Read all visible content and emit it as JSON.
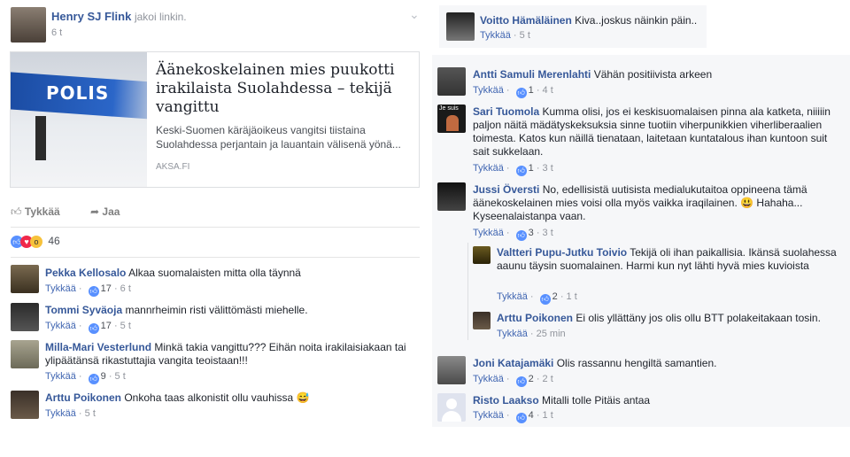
{
  "post": {
    "author": "Henry SJ Flink",
    "action": "jakoi linkin.",
    "time": "6 t",
    "link_title": "Äänekoskelainen mies puukotti irakilaista Suolahdessa – tekijä vangittu",
    "link_desc": "Keski-Suomen käräjäoikeus vangitsi tiistaina Suolahdessa perjantain ja lauantain välisenä yönä...",
    "link_source": "AKSA.FI",
    "police_text": "POLIS",
    "like_label": "Tykkää",
    "share_label": "Jaa",
    "reaction_count": "46"
  },
  "left_comments": [
    {
      "name": "Pekka Kellosalo",
      "text": "Alkaa suomalaisten mitta olla täynnä",
      "like": "Tykkää",
      "count": "17",
      "time": "6 t"
    },
    {
      "name": "Tommi Syväoja",
      "text": "mannrheimin risti välittömästi miehelle.",
      "like": "Tykkää",
      "count": "17",
      "time": "5 t"
    },
    {
      "name": "Milla-Mari Vesterlund",
      "text": "Minkä takia vangittu??? Eihän noita irakilaisiakaan tai ylipäätänsä rikastuttajia vangita teoistaan!!!",
      "like": "Tykkää",
      "count": "9",
      "time": "5 t"
    },
    {
      "name": "Arttu Poikonen",
      "text": "Onkoha taas alkonistit ollu vauhissa 😅",
      "like": "Tykkää",
      "count": "",
      "time": "5 t"
    }
  ],
  "top_right_comment": {
    "name": "Voitto Hämäläinen",
    "text": "Kiva..joskus näinkin päin..",
    "like": "Tykkää",
    "time": "5 t"
  },
  "right_comments": [
    {
      "name": "Antti Samuli Merenlahti",
      "text": "Vähän positiivista arkeen",
      "like": "Tykkää",
      "count": "1",
      "time": "4 t"
    },
    {
      "name": "Sari Tuomola",
      "text": "Kumma olisi, jos ei keskisuomalaisen pinna ala katketa, niiiiin paljon näitä mädätyskeksuksia sinne tuotiin viherpunikkien viherliberaalien toimesta. Katos kun näillä tienataan, laitetaan kuntatalous ihan kuntoon suit sait sukkelaan.",
      "like": "Tykkää",
      "count": "1",
      "time": "3 t",
      "avatar_text": "Je suis"
    },
    {
      "name": "Jussi Översti",
      "text": "No, edellisistä uutisista medialukutaitoa oppineena tämä äänekoskelainen mies voisi olla myös vaikka iraqilainen. 😃 Hahaha... Kyseenalaistanpa vaan.",
      "like": "Tykkää",
      "count": "3",
      "time": "3 t"
    },
    {
      "name": "Valtteri Pupu-Jutku Toivio",
      "text": "Tekijä oli ihan paikallisia. Ikänsä suolahessa aaunu täysin suomalainen. Harmi kun nyt lähti hyvä mies kuvioista",
      "like": "Tykkää",
      "count": "2",
      "time": "1 t"
    },
    {
      "name": "Arttu Poikonen",
      "text": "Ei olis yllättäny jos olis ollu BTT polakeitakaan tosin.",
      "like": "Tykkää",
      "count": "",
      "time": "25 min"
    },
    {
      "name": "Joni Katajamäki",
      "text": "Olis rassannu hengiltä samantien.",
      "like": "Tykkää",
      "count": "2",
      "time": "2 t"
    },
    {
      "name": "Risto Laakso",
      "text": "Mitalli tolle Pitäis antaa",
      "like": "Tykkää",
      "count": "4",
      "time": "1 t"
    }
  ]
}
